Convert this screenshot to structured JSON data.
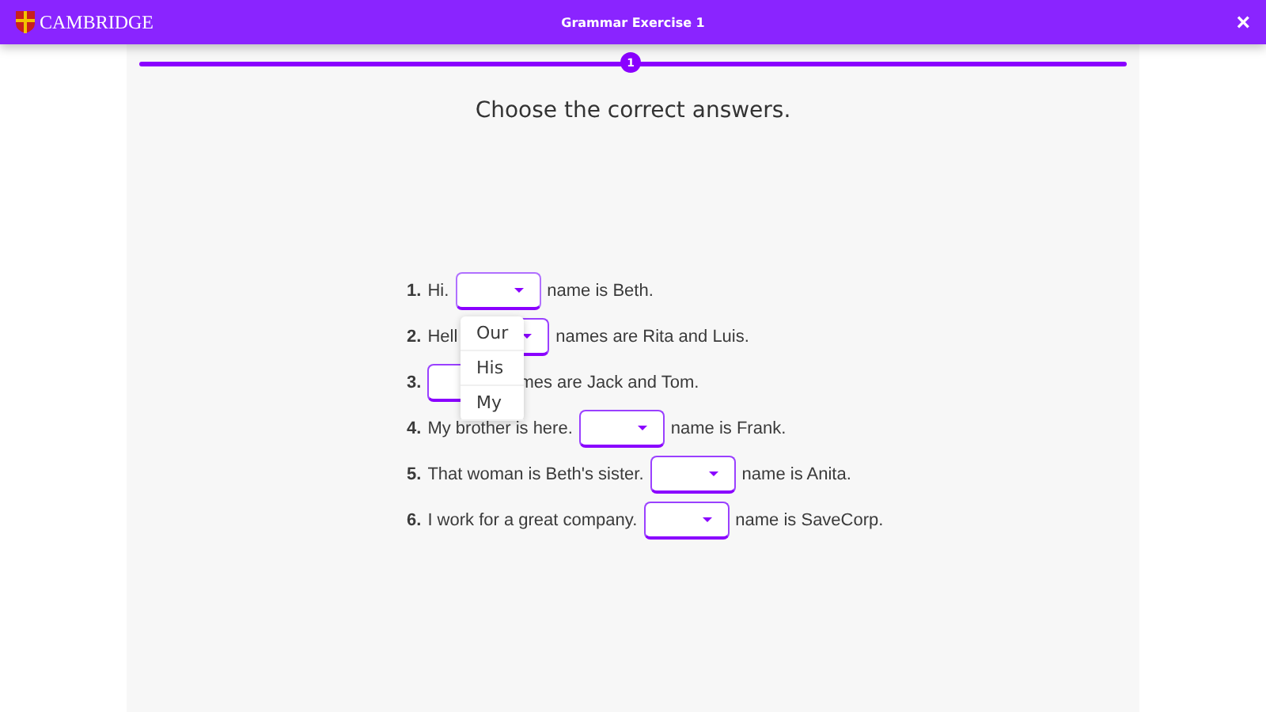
{
  "header": {
    "logo_text": "CAMBRIDGE",
    "title": "Grammar Exercise 1",
    "close": "×"
  },
  "progress": {
    "step": "1"
  },
  "instruction": "Choose the correct answers.",
  "questions": [
    {
      "number": "1.",
      "before": "Hi.",
      "after": "name is Beth.",
      "expanded": true
    },
    {
      "number": "2.",
      "before": "Hell",
      "after": "names are Rita and Luis.",
      "expanded": false
    },
    {
      "number": "3.",
      "after": "mes are Jack and Tom.",
      "expanded": false
    },
    {
      "number": "4.",
      "before": "My brother is here.",
      "after": "name is Frank.",
      "expanded": false
    },
    {
      "number": "5.",
      "before": "That woman is Beth's sister.",
      "after": "name is Anita.",
      "expanded": false
    },
    {
      "number": "6.",
      "before": "I work for a great company.",
      "after": "name is SaveCorp.",
      "expanded": false
    }
  ],
  "dropdown_options": [
    "Our",
    "His",
    "My"
  ]
}
